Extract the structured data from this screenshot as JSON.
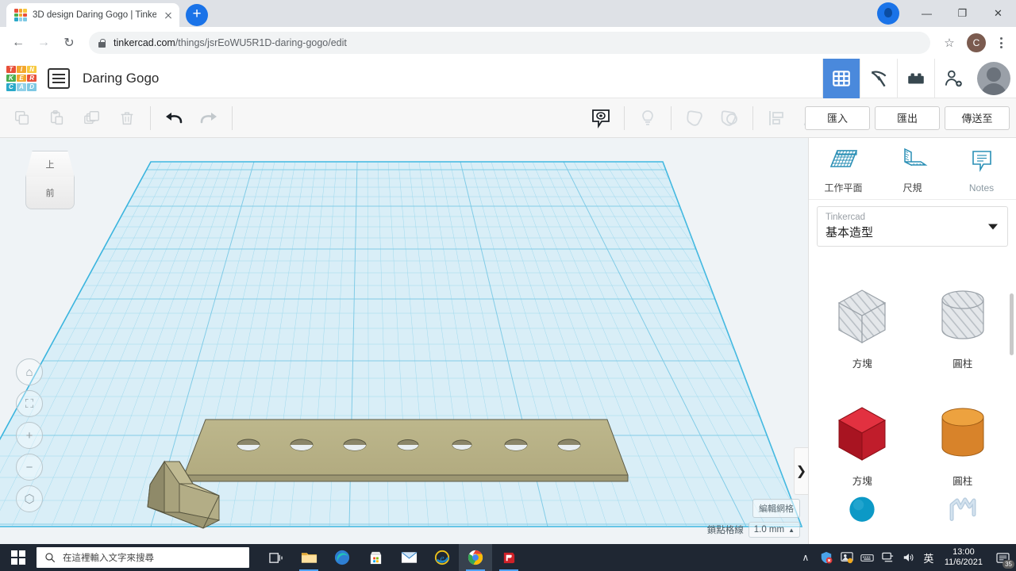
{
  "browser": {
    "tab": {
      "title": "3D design Daring Gogo | Tinke",
      "favicon_name": "tinkercad-favicon"
    },
    "newtab_label": "+",
    "window": {
      "minimize": "—",
      "maximize": "❐",
      "close": "✕"
    },
    "nav": {
      "back": "←",
      "forward": "→",
      "reload": "↻"
    },
    "url_text": "tinkercad.com",
    "url_path": "/things/jsrEoWU5R1D-daring-gogo/edit",
    "star": "☆",
    "account_initial": "C"
  },
  "app": {
    "logo_letters": [
      "T",
      "I",
      "N",
      "K",
      "E",
      "R",
      "C",
      "A",
      "D"
    ],
    "logo_colors": [
      "#e8503a",
      "#f3a72e",
      "#f7c93e",
      "#4caf50",
      "#f3a72e",
      "#e8503a",
      "#2aa9c9",
      "#8fd0e8",
      "#7ec8e3"
    ],
    "project_name": "Daring Gogo",
    "header_icons": [
      {
        "name": "grid-icon",
        "active": true
      },
      {
        "name": "pickaxe-icon",
        "active": false
      },
      {
        "name": "lego-brick-icon",
        "active": false
      },
      {
        "name": "add-person-icon",
        "active": false
      },
      {
        "name": "user-avatar",
        "active": false
      }
    ],
    "toolbar": {
      "left_icons": [
        {
          "name": "copy-icon",
          "disabled": true
        },
        {
          "name": "paste-icon",
          "disabled": true
        },
        {
          "name": "duplicate-icon",
          "disabled": true
        },
        {
          "name": "delete-icon",
          "disabled": true
        }
      ],
      "history_icons": [
        {
          "name": "undo-icon",
          "disabled": false
        },
        {
          "name": "redo-icon",
          "disabled": true
        }
      ],
      "right_icons": [
        {
          "name": "note-icon",
          "disabled": false
        },
        {
          "name": "lightbulb-icon",
          "disabled": true
        },
        {
          "name": "group-icon",
          "disabled": true
        },
        {
          "name": "ungroup-icon",
          "disabled": true
        },
        {
          "name": "align-icon",
          "disabled": true
        },
        {
          "name": "mirror-icon",
          "disabled": true
        }
      ],
      "import_label": "匯入",
      "export_label": "匯出",
      "sendto_label": "傳送至"
    },
    "canvas": {
      "viewcube": {
        "top_label": "上",
        "front_label": "前"
      },
      "nav_buttons": [
        {
          "name": "home-view-icon",
          "glyph": "⌂"
        },
        {
          "name": "fit-view-icon",
          "glyph": "⛶"
        },
        {
          "name": "zoom-in-icon",
          "glyph": "+"
        },
        {
          "name": "zoom-out-icon",
          "glyph": "−"
        },
        {
          "name": "ortho-perspective-icon",
          "glyph": "⬡"
        }
      ],
      "collapse_handle": "❯",
      "edit_grid_label": "編輯網格",
      "snap_grid_label": "鎖點格線",
      "snap_value": "1.0 mm",
      "snap_caret": "▲",
      "objects": [
        {
          "name": "perforated-plate",
          "holes": 7,
          "color": "#b6b083"
        },
        {
          "name": "l-bracket",
          "color": "#b6b083"
        }
      ]
    },
    "panel": {
      "tools": [
        {
          "name": "workplane-tool",
          "label": "工作平面"
        },
        {
          "name": "ruler-tool",
          "label": "尺規"
        },
        {
          "name": "notes-tool",
          "label": "Notes"
        }
      ],
      "library": {
        "source": "Tinkercad",
        "category": "基本造型"
      },
      "shapes": [
        {
          "name": "hollow-box",
          "label": "方塊",
          "kind": "box",
          "color": "#c9ccd0",
          "hollow": true
        },
        {
          "name": "hollow-cylinder",
          "label": "圓柱",
          "kind": "cylinder",
          "color": "#c9ccd0",
          "hollow": true
        },
        {
          "name": "red-box",
          "label": "方塊",
          "kind": "box",
          "color": "#c8202c",
          "hollow": false
        },
        {
          "name": "orange-cylinder",
          "label": "圓柱",
          "kind": "cylinder",
          "color": "#e2892a",
          "hollow": false
        },
        {
          "name": "blue-sphere",
          "label": "",
          "kind": "sphere",
          "color": "#0e9bc8",
          "hollow": false
        },
        {
          "name": "scribble-shape",
          "label": "",
          "kind": "scribble",
          "color": "#b9cfe2",
          "hollow": false
        }
      ]
    }
  },
  "taskbar": {
    "start_name": "windows-start-button",
    "search_placeholder": "在這裡輸入文字來搜尋",
    "apps": [
      {
        "name": "task-view-icon"
      },
      {
        "name": "file-explorer-icon"
      },
      {
        "name": "microsoft-edge-icon"
      },
      {
        "name": "microsoft-store-icon"
      },
      {
        "name": "mail-icon"
      },
      {
        "name": "internet-explorer-icon"
      },
      {
        "name": "google-chrome-icon",
        "active": true
      },
      {
        "name": "powerdirector-icon"
      }
    ],
    "tray": {
      "chevron": "∧",
      "ime_label": "英",
      "time": "13:00",
      "date": "11/6/2021",
      "notification_count": "35"
    }
  }
}
